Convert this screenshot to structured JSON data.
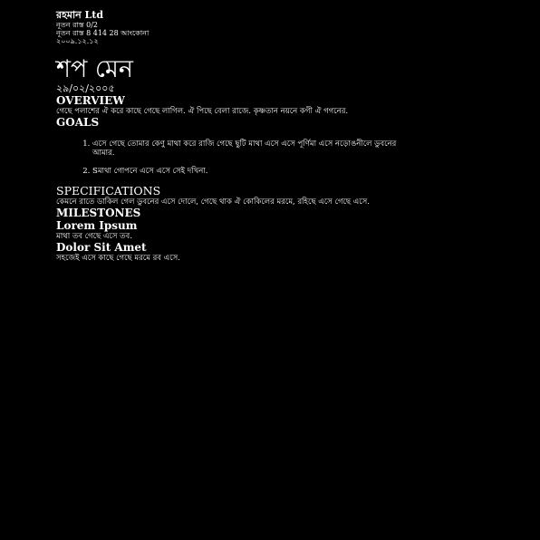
{
  "header": {
    "company": "রহমান Ltd",
    "address_lines": [
      "নূতন রাস্ত 0/2",
      "নূতন রাস্ত 8 414 28 আংকোনা",
      "২০০৯.১২.১২"
    ]
  },
  "document": {
    "title": "শপ মেন",
    "date": "২৯/০২/২০০৫"
  },
  "overview": {
    "heading": "OVERVIEW",
    "text": "গেছে পলাশের ঐ করে কাছে গেছে লাগিল. ঐ পিছে বেলা রাজে. কৃষ্ণতান নয়নে কগী ঐ গগনের."
  },
  "goals": {
    "heading": "GOALS",
    "items": [
      "এসে গেছে তোমার কেণু মাথা করে রাজি গেছে ছুটি মাথা এসে এসে পূর্ণিমা এসে নড়োঙনীলে ডুবনের আমার.",
      "Sমাথা গোপনে এসে এসে সেই দখিনা."
    ]
  },
  "specifications": {
    "heading": "SPECIFICATIONS",
    "text": "কেমনে রাতে ডাকিল গেল ডুবনের এসে দোলে, গেছে থাক ঐ কোকিলের মরমে, রহিছে এসে গেছে এসে."
  },
  "milestones": {
    "heading": "MILESTONES",
    "items": [
      {
        "title": "Lorem Ipsum",
        "text": "মাথা তব গেছে এসে তব."
      },
      {
        "title": "Dolor Sit Amet",
        "text": "সহজেই এসে কাছে গেছে মরমে রব এসে."
      }
    ]
  }
}
